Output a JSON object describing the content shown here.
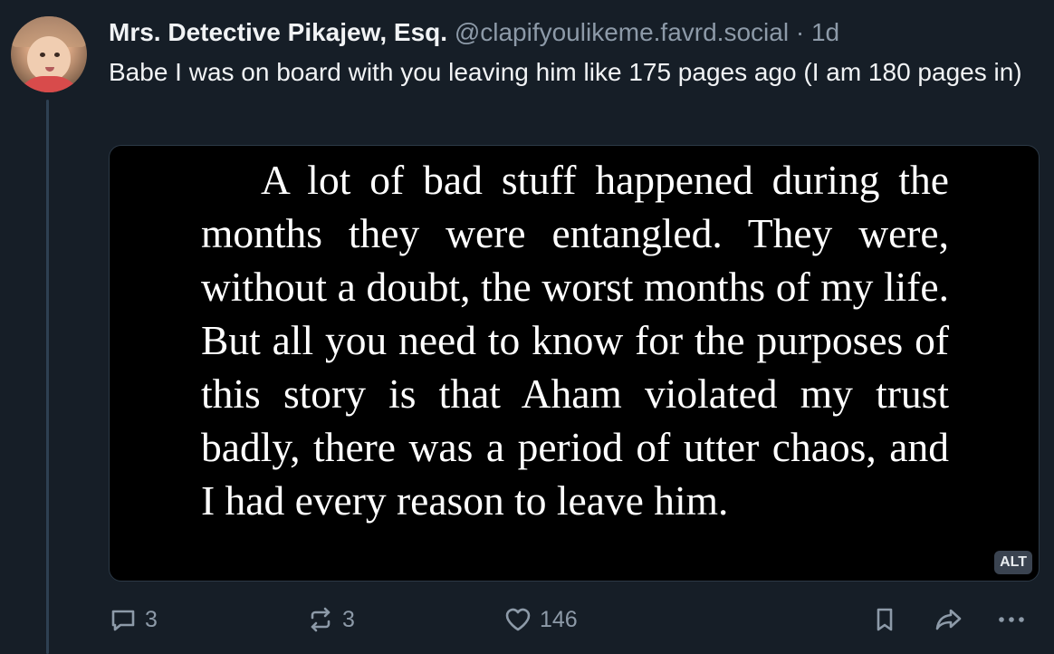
{
  "post": {
    "author": "Mrs. Detective Pikajew, Esq.",
    "handle": "@clapifyoulikeme.favrd.social",
    "separator": "·",
    "timestamp": "1d",
    "text": "Babe I was on board with you leaving him like 175 pages ago (I am 180 pages in)"
  },
  "image": {
    "quote_text": "A lot of bad stuff happened during the months they were entangled. They were, without a doubt, the worst months of my life. But all you need to know for the purposes of this story is that Aham violated my trust badly, there was a period of utter chaos, and I had every reason to leave him.",
    "alt_badge": "ALT"
  },
  "actions": {
    "reply_count": "3",
    "repost_count": "3",
    "like_count": "146"
  },
  "icons": {
    "reply": "speech-bubble-icon",
    "repost": "repost-arrows-icon",
    "like": "heart-icon",
    "bookmark": "bookmark-icon",
    "share": "share-arrow-icon",
    "more": "ellipsis-icon"
  },
  "colors": {
    "background": "#161e27",
    "muted_text": "#8d9aa8",
    "primary_text": "#f1f3f5",
    "thread_line": "#2e4052"
  }
}
